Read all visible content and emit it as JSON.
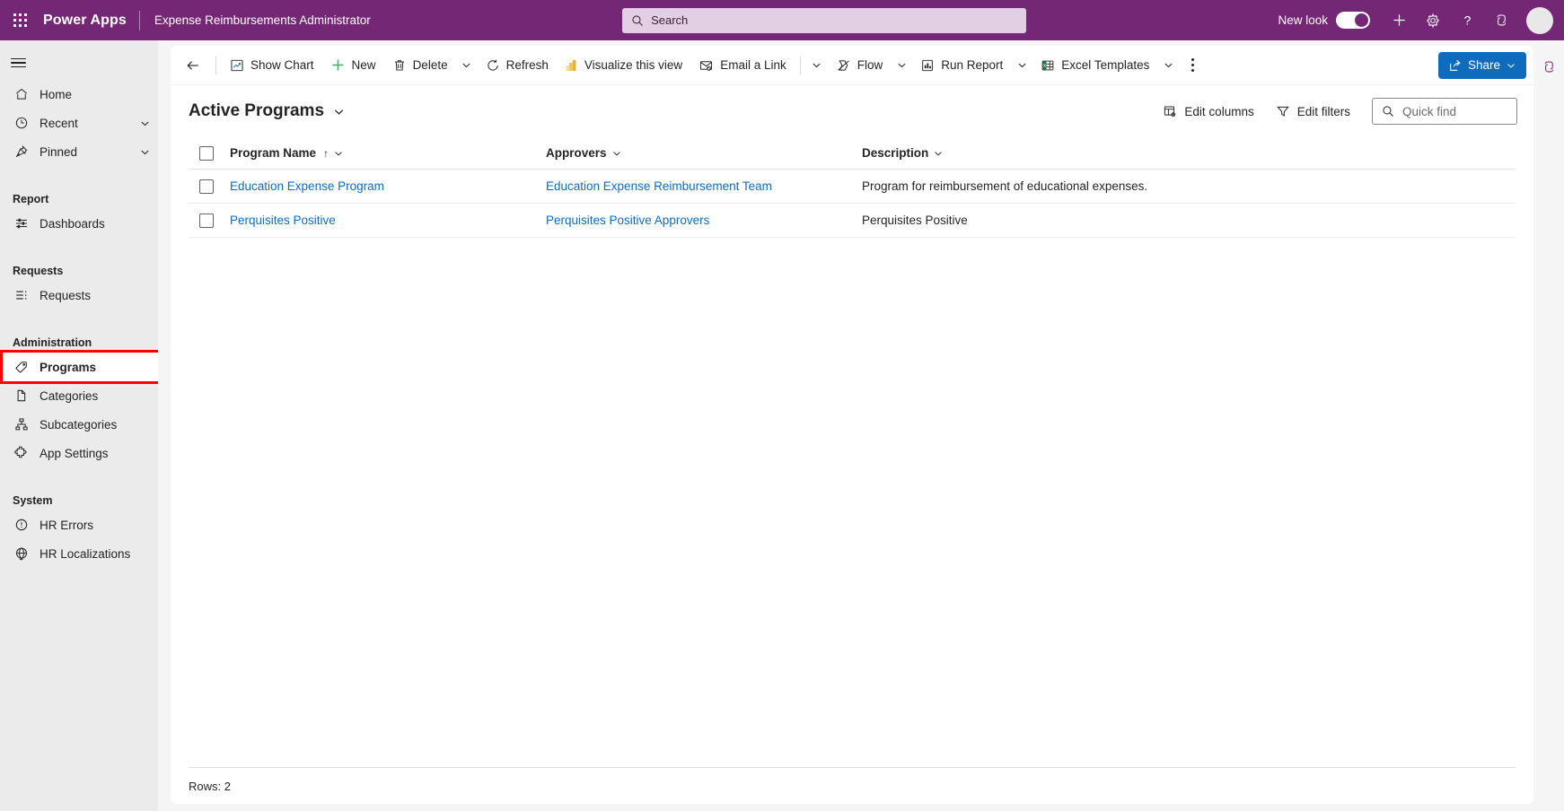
{
  "topbar": {
    "waffle_label": "app-launcher",
    "brand": "Power Apps",
    "app_name": "Expense Reimbursements Administrator",
    "search_placeholder": "Search",
    "new_look_label": "New look",
    "new_look_on": true,
    "icons": [
      "plus-icon",
      "gear-icon",
      "help-icon",
      "copilot-icon"
    ],
    "brand_color": "#742774",
    "search_bg": "#e3cfe3"
  },
  "sidebar": {
    "hamburger_label": "Site map",
    "items": [
      {
        "label": "Home",
        "icon": "home-icon",
        "chevron": false,
        "selected": false
      },
      {
        "label": "Recent",
        "icon": "clock-icon",
        "chevron": true,
        "selected": false
      },
      {
        "label": "Pinned",
        "icon": "pin-icon",
        "chevron": true,
        "selected": false
      }
    ],
    "groups": [
      {
        "title": "Report",
        "items": [
          {
            "label": "Dashboards",
            "icon": "dashboard-icon",
            "selected": false
          }
        ]
      },
      {
        "title": "Requests",
        "items": [
          {
            "label": "Requests",
            "icon": "list-icon",
            "selected": false
          }
        ]
      },
      {
        "title": "Administration",
        "items": [
          {
            "label": "Programs",
            "icon": "tag-icon",
            "selected": true
          },
          {
            "label": "Categories",
            "icon": "document-icon",
            "selected": false
          },
          {
            "label": "Subcategories",
            "icon": "hierarchy-icon",
            "selected": false
          },
          {
            "label": "App Settings",
            "icon": "puzzle-icon",
            "selected": false
          }
        ]
      },
      {
        "title": "System",
        "items": [
          {
            "label": "HR Errors",
            "icon": "error-circle-icon",
            "selected": false
          },
          {
            "label": "HR Localizations",
            "icon": "globe-icon",
            "selected": false
          }
        ]
      }
    ],
    "highlight": {
      "target": "Programs",
      "color": "#ff0000"
    }
  },
  "commandbar": {
    "back_label": "Back",
    "buttons": [
      {
        "label": "Show Chart",
        "icon": "chart-icon",
        "caret": false
      },
      {
        "label": "New",
        "icon": "plus-green-icon",
        "caret": false
      },
      {
        "label": "Delete",
        "icon": "trash-icon",
        "caret": false
      },
      {
        "label": "",
        "icon": "",
        "caret": true
      },
      {
        "label": "Refresh",
        "icon": "refresh-icon",
        "caret": false
      },
      {
        "label": "Visualize this view",
        "icon": "powerbi-icon",
        "caret": false
      },
      {
        "label": "Email a Link",
        "icon": "email-link-icon",
        "caret": false
      },
      {
        "label": "",
        "icon": "",
        "caret": true
      },
      {
        "label": "Flow",
        "icon": "flow-icon",
        "caret": true
      },
      {
        "label": "Run Report",
        "icon": "report-icon",
        "caret": true
      },
      {
        "label": "Excel Templates",
        "icon": "excel-icon",
        "caret": true
      }
    ],
    "overflow_label": "More commands",
    "share": {
      "label": "Share",
      "icon": "share-icon",
      "caret": true,
      "color": "#0f6cbd"
    }
  },
  "view": {
    "title": "Active Programs",
    "edit_columns_label": "Edit columns",
    "edit_filters_label": "Edit filters",
    "quick_find_placeholder": "Quick find"
  },
  "grid": {
    "columns": [
      {
        "label": "Program Name",
        "sorted": true,
        "sort_dir": "↑"
      },
      {
        "label": "Approvers",
        "sorted": false,
        "sort_dir": ""
      },
      {
        "label": "Description",
        "sorted": false,
        "sort_dir": ""
      }
    ],
    "rows": [
      {
        "name": "Education Expense Program",
        "approvers": "Education Expense Reimbursement Team",
        "description": "Program for reimbursement of educational expenses."
      },
      {
        "name": "Perquisites Positive",
        "approvers": "Perquisites Positive Approvers",
        "description": "Perquisites Positive"
      }
    ],
    "link_color": "#0f6cbd"
  },
  "status": {
    "rows_label": "Rows: 2"
  },
  "rightrail": {
    "icon": "copilot-icon"
  }
}
